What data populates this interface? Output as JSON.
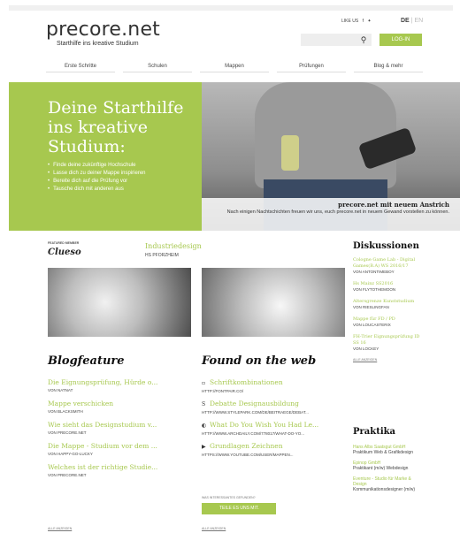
{
  "header": {
    "logo_title": "precore.net",
    "logo_sub": "Starthilfe ins kreative Studium",
    "likeus": "LIKE US",
    "lang_active": "DE",
    "lang_inactive": "EN",
    "login_label": "LOG-IN"
  },
  "nav": [
    "Erste Schritte",
    "Schulen",
    "Mappen",
    "Prüfungen",
    "Blog & mehr"
  ],
  "hero": {
    "title": "Deine Starthilfe ins kreative Studium:",
    "bullets": [
      "Finde deine zukünftige Hochschule",
      "Lasse dich zu deiner Mappe inspirieren",
      "Bereite dich auf die Prüfung vor",
      "Tausche dich mit anderen aus"
    ],
    "caption_title": "precore.net mit neuem Anstrich",
    "caption_text": "Nach einigen Nachtschichten freuen wir uns, euch precore.net in neuem Gewand vorstellen zu können."
  },
  "featured": {
    "label": "FEATURED MEMBER",
    "name": "Clueso",
    "project": "Industriedesign",
    "place": "HS PFORZHEIM"
  },
  "blog": {
    "heading": "Blogfeature",
    "items": [
      {
        "title": "Die Eignungsprüfung, Hürde o...",
        "meta": "VON NATNAT"
      },
      {
        "title": "Mappe verschicken",
        "meta": "VON BLACKSMITH"
      },
      {
        "title": "Wie sieht das Designstudium v...",
        "meta": "VON PRECORE.NET"
      },
      {
        "title": "Die Mappe - Studium vor dem ...",
        "meta": "VON HAPPY-GO-LUCKY"
      },
      {
        "title": "Welches ist der richtige Studie...",
        "meta": "VON PRECORE.NET"
      }
    ],
    "all": "ALLE ANZEIGEN"
  },
  "web": {
    "heading": "Found on the web",
    "items": [
      {
        "icon": "▫",
        "title": "Schriftkombinationen",
        "url": "HTTP://FONTPAIR.CO/"
      },
      {
        "icon": "S",
        "title": "Debatte Designausbildung",
        "url": "HTTP://WWW.STYLEPARK.COM/DE/BEITRAEGE/DEBAT..."
      },
      {
        "icon": "◐",
        "title": "What Do You Wish You Had Le...",
        "url": "HTTP://WWW.ARCHDAILY.COM/778017/WHAT-DO-YO..."
      },
      {
        "icon": "▶",
        "title": "Grundlagen Zeichnen",
        "url": "HTTPS://WWW.YOUTUBE.COM/USER/MAPPEN..."
      }
    ],
    "share_label": "WAS INTERESSANTES GEFUNDEN?",
    "share_button": "TEILE ES UNS MIT.",
    "all": "ALLE ANZEIGEN"
  },
  "discussions": {
    "heading": "Diskussionen",
    "items": [
      {
        "title": "Cologne Game Lab - Digital Games(B.A) WS 2016/17",
        "meta": "VON ANTONTIMEBOY"
      },
      {
        "title": "Hs Mainz SS2016",
        "meta": "VON FLYTOTHEMOON"
      },
      {
        "title": "Altersgrenze Kunststudium",
        "meta": "VON RIESLINGFAN"
      },
      {
        "title": "Mappe für FD / PD",
        "meta": "VON LOUCASTERIX"
      },
      {
        "title": "FH-Trier Eignungsprüfung ID SS 16",
        "meta": "VON LOCKEY"
      }
    ],
    "all": "ALLE ANZEIGEN"
  },
  "praktika": {
    "heading": "Praktika",
    "items": [
      {
        "title": "Hans Albs Saatsgut GmbH",
        "meta": "Praktikum Web & Grafikdesign"
      },
      {
        "title": "Epinop GmbH",
        "meta": "Praktikant (m/w) Webdesign"
      },
      {
        "title": "Eventure - Studio für Marke & Design",
        "meta": "Kommunikationsdesigner (m/w)"
      }
    ]
  },
  "colors": {
    "accent": "#a7c84f",
    "text": "#333333"
  }
}
